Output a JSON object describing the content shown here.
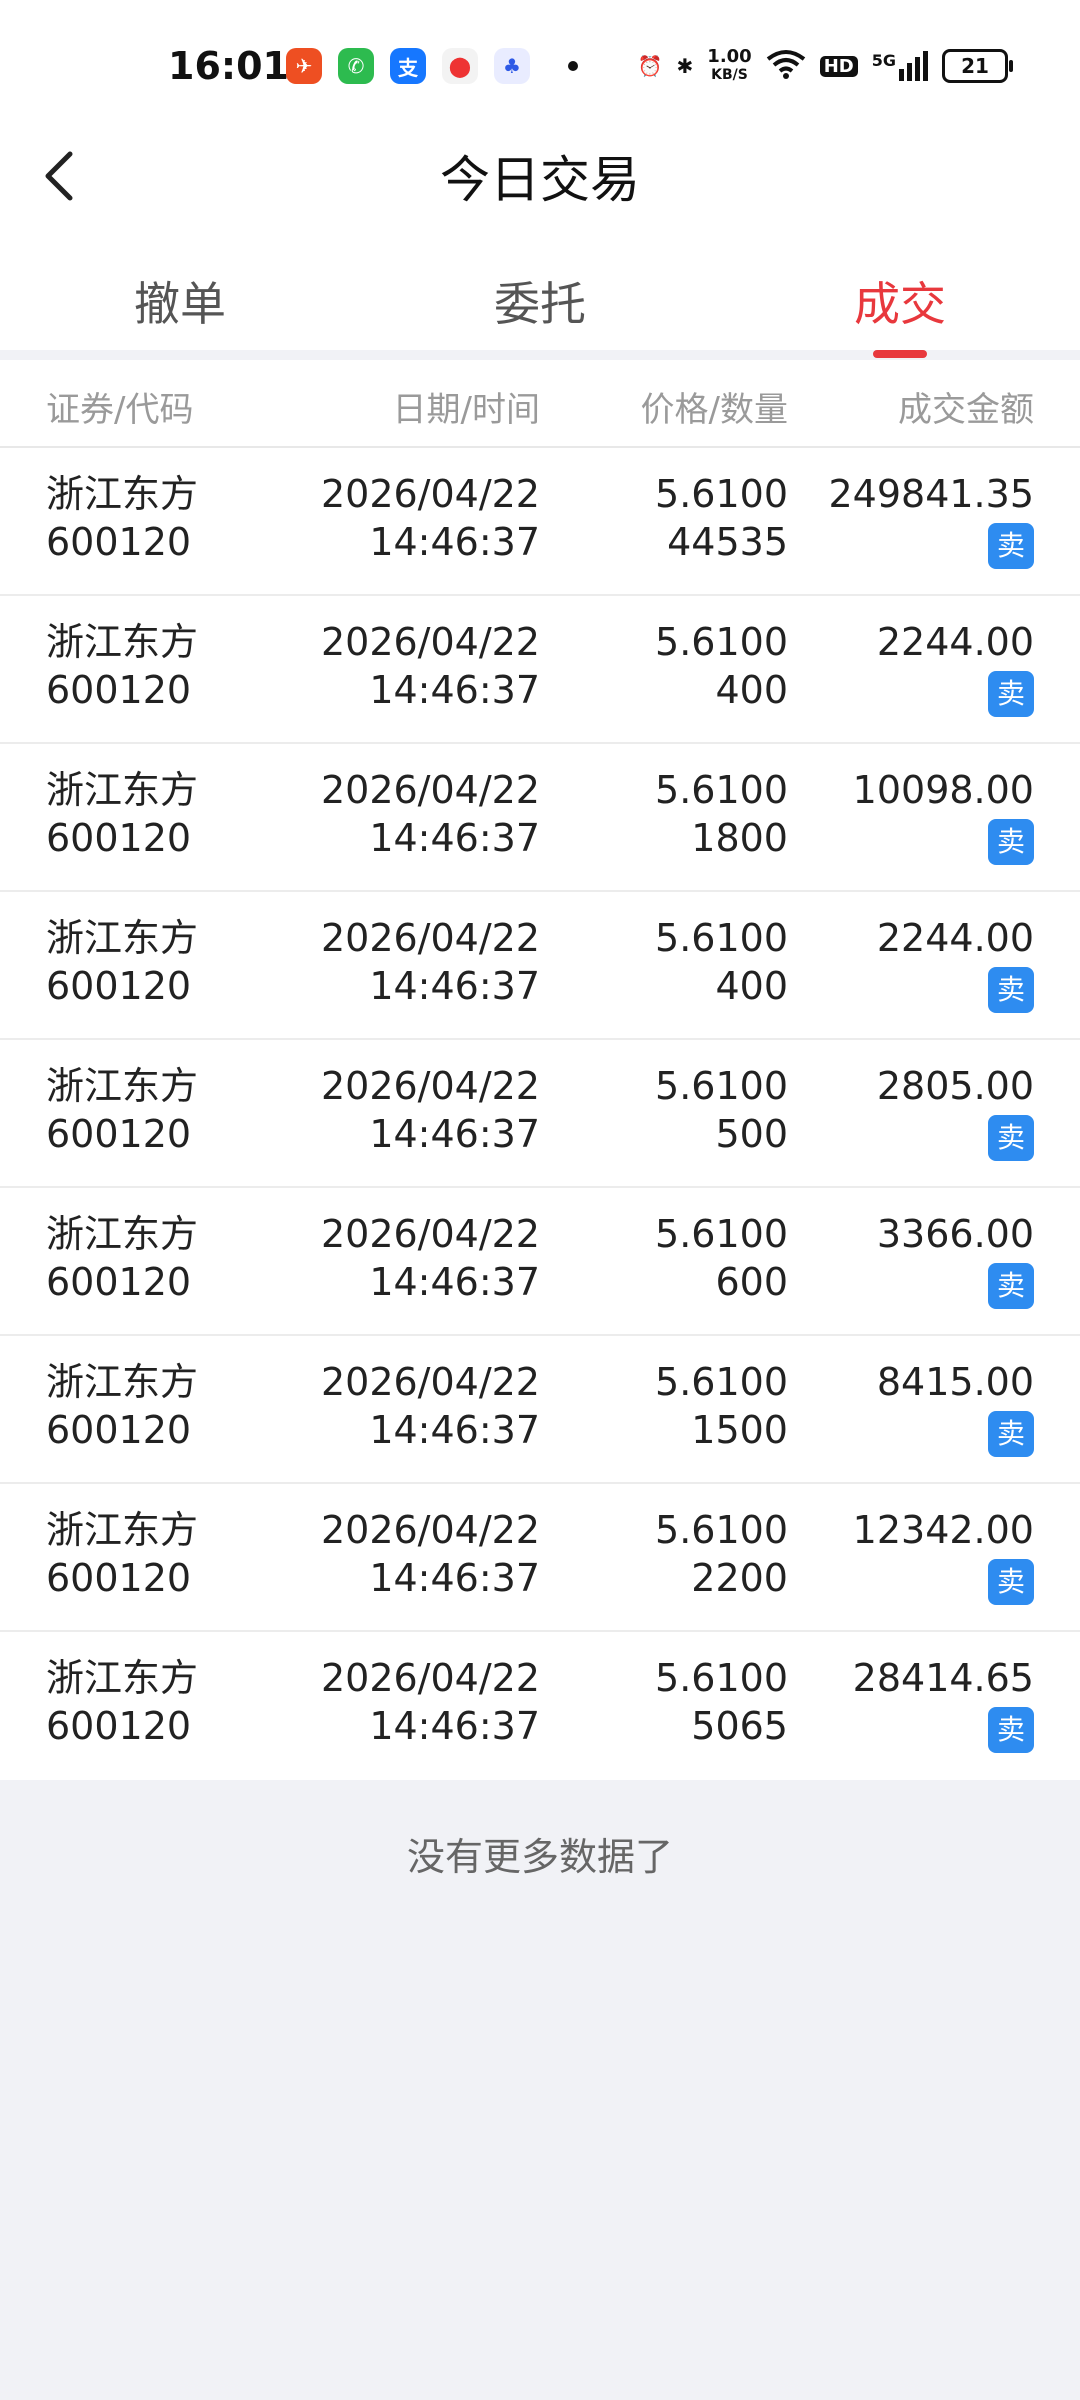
{
  "status": {
    "time": "16:01",
    "net_speed_top": "1.00",
    "net_speed_bottom": "KB/S",
    "hd": "HD",
    "five_g": "5G",
    "battery": "21"
  },
  "header": {
    "title": "今日交易"
  },
  "tabs": [
    {
      "label": "撤单"
    },
    {
      "label": "委托"
    },
    {
      "label": "成交"
    }
  ],
  "columns": [
    "证券/代码",
    "日期/时间",
    "价格/数量",
    "成交金额"
  ],
  "rows": [
    {
      "name": "浙江东方",
      "code": "600120",
      "date": "2026/04/22",
      "time": "14:46:37",
      "price": "5.6100",
      "qty": "44535",
      "amount": "249841.35",
      "side": "卖"
    },
    {
      "name": "浙江东方",
      "code": "600120",
      "date": "2026/04/22",
      "time": "14:46:37",
      "price": "5.6100",
      "qty": "400",
      "amount": "2244.00",
      "side": "卖"
    },
    {
      "name": "浙江东方",
      "code": "600120",
      "date": "2026/04/22",
      "time": "14:46:37",
      "price": "5.6100",
      "qty": "1800",
      "amount": "10098.00",
      "side": "卖"
    },
    {
      "name": "浙江东方",
      "code": "600120",
      "date": "2026/04/22",
      "time": "14:46:37",
      "price": "5.6100",
      "qty": "400",
      "amount": "2244.00",
      "side": "卖"
    },
    {
      "name": "浙江东方",
      "code": "600120",
      "date": "2026/04/22",
      "time": "14:46:37",
      "price": "5.6100",
      "qty": "500",
      "amount": "2805.00",
      "side": "卖"
    },
    {
      "name": "浙江东方",
      "code": "600120",
      "date": "2026/04/22",
      "time": "14:46:37",
      "price": "5.6100",
      "qty": "600",
      "amount": "3366.00",
      "side": "卖"
    },
    {
      "name": "浙江东方",
      "code": "600120",
      "date": "2026/04/22",
      "time": "14:46:37",
      "price": "5.6100",
      "qty": "1500",
      "amount": "8415.00",
      "side": "卖"
    },
    {
      "name": "浙江东方",
      "code": "600120",
      "date": "2026/04/22",
      "time": "14:46:37",
      "price": "5.6100",
      "qty": "2200",
      "amount": "12342.00",
      "side": "卖"
    },
    {
      "name": "浙江东方",
      "code": "600120",
      "date": "2026/04/22",
      "time": "14:46:37",
      "price": "5.6100",
      "qty": "5065",
      "amount": "28414.65",
      "side": "卖"
    }
  ],
  "footer": "没有更多数据了",
  "colors": {
    "accent_red": "#e8383d",
    "sell_blue": "#2e8cf0"
  }
}
